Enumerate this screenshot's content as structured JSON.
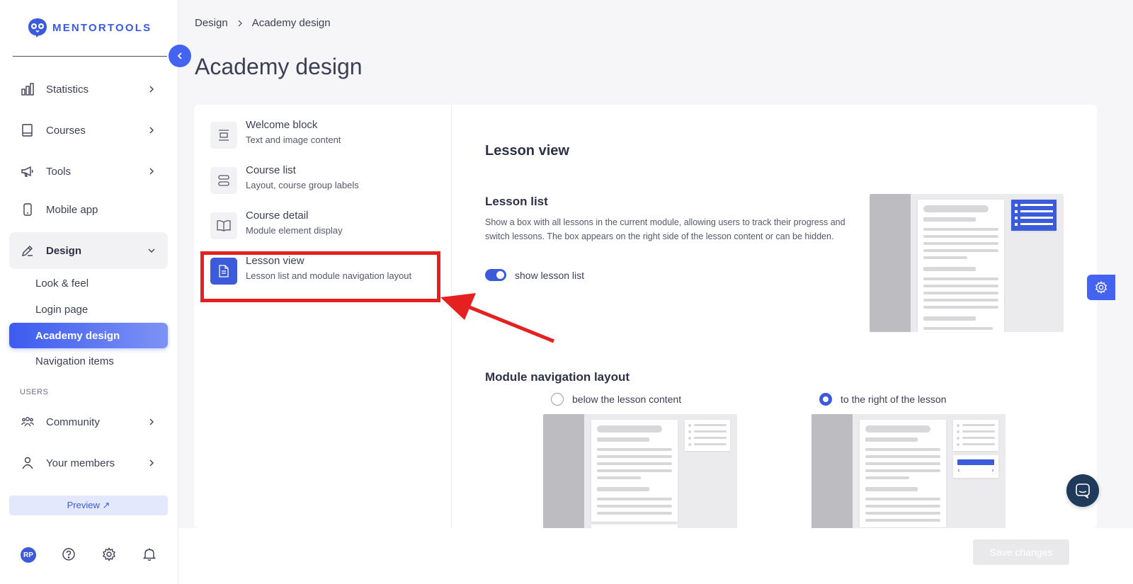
{
  "brand": {
    "name": "MENTORTOOLS"
  },
  "sidebar": {
    "items": [
      {
        "label": "Statistics",
        "icon": "bar-chart-icon"
      },
      {
        "label": "Courses",
        "icon": "book-icon"
      },
      {
        "label": "Tools",
        "icon": "megaphone-icon"
      },
      {
        "label": "Mobile app",
        "icon": "phone-icon"
      },
      {
        "label": "Design",
        "icon": "pencil-icon"
      }
    ],
    "design_subitems": [
      "Look & feel",
      "Login page",
      "Academy design",
      "Navigation items"
    ],
    "users_section_label": "USERS",
    "user_items": [
      {
        "label": "Community",
        "icon": "people-icon"
      },
      {
        "label": "Your members",
        "icon": "person-icon"
      }
    ],
    "preview_label": "Preview ↗",
    "avatar_initials": "RP"
  },
  "breadcrumb": {
    "parent": "Design",
    "separator": ">",
    "current": "Academy design"
  },
  "page_title": "Academy design",
  "menu": [
    {
      "title": "Welcome block",
      "subtitle": "Text and image content"
    },
    {
      "title": "Course list",
      "subtitle": "Layout, course group labels"
    },
    {
      "title": "Course detail",
      "subtitle": "Module element display"
    },
    {
      "title": "Lesson view",
      "subtitle": "Lesson list and module navigation layout"
    }
  ],
  "content": {
    "section_title": "Lesson view",
    "lesson_list_title": "Lesson list",
    "lesson_list_desc": "Show a box with all lessons in the current module, allowing users to track their progress and switch lessons. The box appears on the right side of the lesson content or can be hidden.",
    "toggle_label": "show lesson list",
    "toggle_on": true,
    "module_nav_title": "Module navigation layout",
    "radio_options": [
      {
        "label": "below the lesson content",
        "checked": false
      },
      {
        "label": "to the right of the lesson",
        "checked": true
      }
    ]
  },
  "footer": {
    "save_label": "Save changes"
  },
  "colors": {
    "accent": "#3b5bdb",
    "highlight": "#e52020"
  }
}
